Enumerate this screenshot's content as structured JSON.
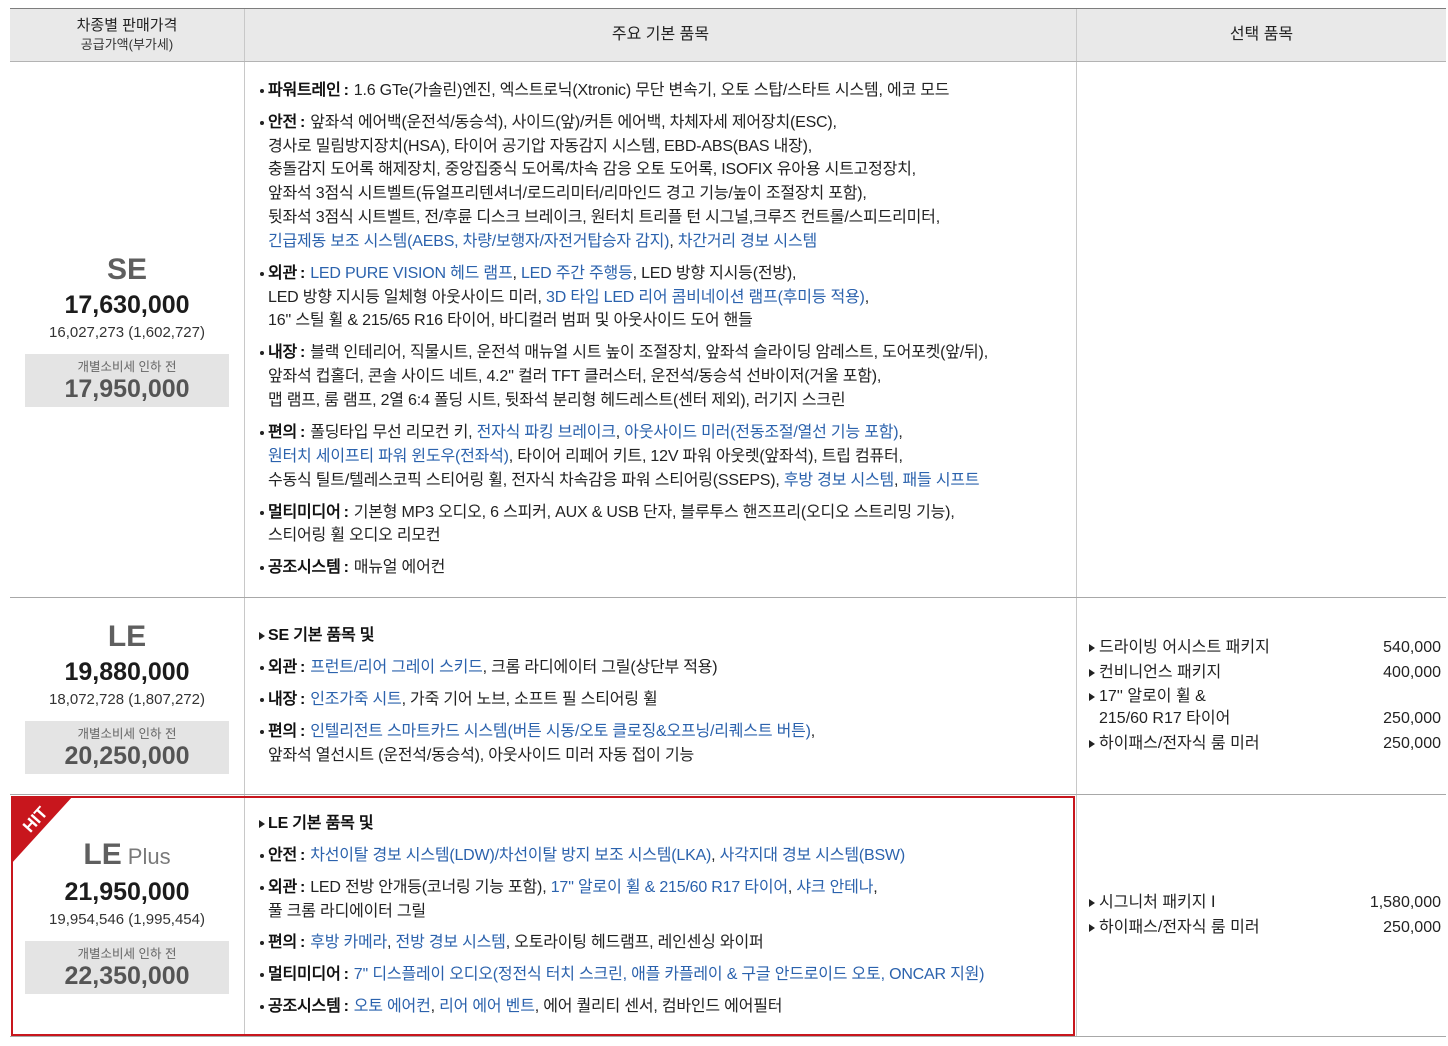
{
  "header": {
    "col1_title": "차종별 판매가격",
    "col1_subtitle": "공급가액(부가세)",
    "col2_title": "주요 기본 품목",
    "col3_title": "선택 품목"
  },
  "label_separator": ":",
  "colors": {
    "highlight_text": "#2b62ad",
    "hit_badge": "#c8161d",
    "model_name": "#5f5f5f",
    "header_bg": "#e9e9e9",
    "pre_tax_box_bg": "#e4e4e4"
  },
  "icons": {
    "feature_bullet": "bullet-dot-icon",
    "base_note_bullet": "triangle-right-icon",
    "option_bullet": "triangle-right-icon"
  },
  "trims": [
    {
      "model": "SE",
      "price": "17,630,000",
      "supply_price": "16,027,273 (1,602,727)",
      "pre_tax_label": "개별소비세 인하 전",
      "pre_tax_price": "17,950,000",
      "features": [
        {
          "label": "파워트레인",
          "lines": [
            [
              {
                "t": "1.6 GTe(가솔린)엔진, 엑스트로닉(Xtronic) 무단 변속기, 오토 스탑/스타트 시스템, 에코 모드"
              }
            ]
          ]
        },
        {
          "label": "안전",
          "lines": [
            [
              {
                "t": "앞좌석 에어백(운전석/동승석), 사이드(앞)/커튼 에어백, 차체자세 제어장치(ESC),"
              }
            ],
            [
              {
                "t": "경사로 밀림방지장치(HSA), 타이어 공기압 자동감지 시스템, EBD-ABS(BAS 내장),"
              }
            ],
            [
              {
                "t": "충돌감지 도어록 해제장치, 중앙집중식 도어록/차속 감응 오토 도어록, ISOFIX 유아용 시트고정장치,"
              }
            ],
            [
              {
                "t": "앞좌석 3점식 시트벨트(듀얼프리텐셔너/로드리미터/리마인드 경고 기능/높이 조절장치 포함),"
              }
            ],
            [
              {
                "t": "뒷좌석 3점식 시트벨트, 전/후륜 디스크 브레이크, 원터치 트리플 턴 시그널,크루즈 컨트롤/스피드리미터,"
              }
            ],
            [
              {
                "t": "긴급제동 보조 시스템(AEBS, 차량/보행자/자전거탑승자 감지)",
                "hl": true
              },
              {
                "t": ", "
              },
              {
                "t": "차간거리 경보 시스템",
                "hl": true
              }
            ]
          ]
        },
        {
          "label": "외관",
          "lines": [
            [
              {
                "t": "LED PURE VISION 헤드 램프",
                "hl": true
              },
              {
                "t": ", "
              },
              {
                "t": "LED 주간 주행등",
                "hl": true
              },
              {
                "t": ", LED 방향 지시등(전방),"
              }
            ],
            [
              {
                "t": "LED 방향 지시등 일체형 아웃사이드 미러, "
              },
              {
                "t": "3D 타입 LED 리어 콤비네이션 램프(후미등 적용)",
                "hl": true
              },
              {
                "t": ","
              }
            ],
            [
              {
                "t": "16'' 스틸 휠 & 215/65 R16 타이어, 바디컬러 범퍼 및 아웃사이드 도어 핸들"
              }
            ]
          ]
        },
        {
          "label": "내장",
          "lines": [
            [
              {
                "t": "블랙 인테리어, 직물시트, 운전석 매뉴얼 시트 높이 조절장치, 앞좌석 슬라이딩 암레스트, 도어포켓(앞/뒤),"
              }
            ],
            [
              {
                "t": "앞좌석 컵홀더, 콘솔 사이드 네트, 4.2'' 컬러 TFT 클러스터, 운전석/동승석 선바이저(거울 포함),"
              }
            ],
            [
              {
                "t": "맵 램프, 룸 램프, 2열 6:4 폴딩 시트, 뒷좌석 분리형 헤드레스트(센터 제외), 러기지 스크린"
              }
            ]
          ]
        },
        {
          "label": "편의",
          "lines": [
            [
              {
                "t": "폴딩타입 무선 리모컨 키, "
              },
              {
                "t": "전자식 파킹 브레이크",
                "hl": true
              },
              {
                "t": ", "
              },
              {
                "t": "아웃사이드 미러(전동조절/열선 기능 포함)",
                "hl": true
              },
              {
                "t": ","
              }
            ],
            [
              {
                "t": "원터치 세이프티 파워 윈도우(전좌석)",
                "hl": true
              },
              {
                "t": ", 타이어 리페어 키트, 12V 파워 아웃렛(앞좌석), 트립 컴퓨터,"
              }
            ],
            [
              {
                "t": "수동식 틸트/텔레스코픽 스티어링 휠, 전자식 차속감응 파워 스티어링(SSEPS), "
              },
              {
                "t": "후방 경보 시스템",
                "hl": true
              },
              {
                "t": ", "
              },
              {
                "t": "패들 시프트",
                "hl": true
              }
            ]
          ]
        },
        {
          "label": "멀티미디어",
          "lines": [
            [
              {
                "t": "기본형 MP3 오디오, 6 스피커, AUX & USB 단자, 블루투스 핸즈프리(오디오 스트리밍 기능),"
              }
            ],
            [
              {
                "t": "스티어링 휠 오디오 리모컨"
              }
            ]
          ]
        },
        {
          "label": "공조시스템",
          "lines": [
            [
              {
                "t": "매뉴얼 에어컨"
              }
            ]
          ]
        }
      ],
      "options": []
    },
    {
      "model": "LE",
      "price": "19,880,000",
      "supply_price": "18,072,728 (1,807,272)",
      "pre_tax_label": "개별소비세 인하 전",
      "pre_tax_price": "20,250,000",
      "base_note": "SE 기본 품목 및",
      "features": [
        {
          "label": "외관",
          "lines": [
            [
              {
                "t": "프런트/리어 그레이 스키드",
                "hl": true
              },
              {
                "t": ", 크롬 라디에이터 그릴(상단부 적용)"
              }
            ]
          ]
        },
        {
          "label": "내장",
          "lines": [
            [
              {
                "t": "인조가죽 시트",
                "hl": true
              },
              {
                "t": ", 가죽 기어 노브, 소프트 필 스티어링 휠"
              }
            ]
          ]
        },
        {
          "label": "편의",
          "lines": [
            [
              {
                "t": "인텔리전트 스마트카드 시스템(버튼 시동/오토 클로징&오프닝/리퀘스트 버튼)",
                "hl": true
              },
              {
                "t": ","
              }
            ],
            [
              {
                "t": "앞좌석 열선시트 (운전석/동승석), 아웃사이드 미러 자동 접이 기능"
              }
            ]
          ]
        }
      ],
      "options": [
        {
          "name": [
            "드라이빙 어시스트 패키지"
          ],
          "price": "540,000"
        },
        {
          "name": [
            "컨비니언스 패키지"
          ],
          "price": "400,000"
        },
        {
          "name": [
            "17'' 알로이 휠 &",
            "215/60 R17 타이어"
          ],
          "price": "250,000"
        },
        {
          "name": [
            "하이패스/전자식 룸 미러"
          ],
          "price": "250,000"
        }
      ]
    },
    {
      "model": "LE",
      "model_suffix": "Plus",
      "badge": "HIT",
      "featured": true,
      "price": "21,950,000",
      "supply_price": "19,954,546 (1,995,454)",
      "pre_tax_label": "개별소비세 인하 전",
      "pre_tax_price": "22,350,000",
      "base_note": "LE 기본 품목 및",
      "features": [
        {
          "label": "안전",
          "lines": [
            [
              {
                "t": "차선이탈 경보 시스템(LDW)/차선이탈 방지 보조 시스템(LKA)",
                "hl": true
              },
              {
                "t": ", "
              },
              {
                "t": "사각지대 경보 시스템(BSW)",
                "hl": true
              }
            ]
          ]
        },
        {
          "label": "외관",
          "lines": [
            [
              {
                "t": "LED 전방 안개등(코너링 기능 포함), "
              },
              {
                "t": "17'' 알로이 휠 & 215/60 R17 타이어",
                "hl": true
              },
              {
                "t": ", "
              },
              {
                "t": "샤크 안테나",
                "hl": true
              },
              {
                "t": ","
              }
            ],
            [
              {
                "t": "풀 크롬 라디에이터 그릴"
              }
            ]
          ]
        },
        {
          "label": "편의",
          "lines": [
            [
              {
                "t": "후방 카메라",
                "hl": true
              },
              {
                "t": ", "
              },
              {
                "t": "전방 경보 시스템",
                "hl": true
              },
              {
                "t": ", 오토라이팅 헤드램프, 레인센싱 와이퍼"
              }
            ]
          ]
        },
        {
          "label": "멀티미디어",
          "lines": [
            [
              {
                "t": "7'' 디스플레이 오디오(정전식 터치 스크린, 애플 카플레이 & 구글 안드로이드 오토, ONCAR 지원)",
                "hl": true
              }
            ]
          ]
        },
        {
          "label": "공조시스템",
          "lines": [
            [
              {
                "t": "오토 에어컨",
                "hl": true
              },
              {
                "t": ", "
              },
              {
                "t": "리어 에어 벤트",
                "hl": true
              },
              {
                "t": ", 에어 퀄리티 센서, 컴바인드 에어필터"
              }
            ]
          ]
        }
      ],
      "options": [
        {
          "name": [
            "시그니처 패키지 Ⅰ"
          ],
          "price": "1,580,000"
        },
        {
          "name": [
            "하이패스/전자식 룸 미러"
          ],
          "price": "250,000"
        }
      ]
    }
  ]
}
